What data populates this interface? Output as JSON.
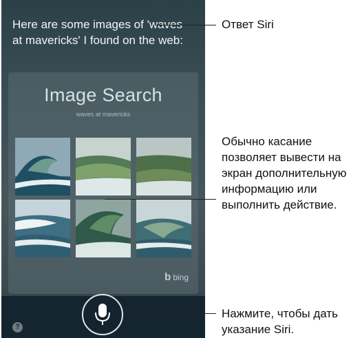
{
  "siri": {
    "response_text": "Here are some images of 'waves at mavericks' I found on the web:"
  },
  "card": {
    "title": "Image Search",
    "subtitle": "waves at mavericks",
    "logo_text": "bing",
    "images": [
      {
        "name": "wave-image-1"
      },
      {
        "name": "wave-image-2"
      },
      {
        "name": "wave-image-3"
      },
      {
        "name": "wave-image-4"
      },
      {
        "name": "wave-image-5"
      },
      {
        "name": "wave-image-6"
      }
    ]
  },
  "buttons": {
    "mic": "microphone-icon",
    "help": "?"
  },
  "callouts": {
    "siri_answer": "Ответ Siri",
    "tap_info": "Обычно касание позволяет вывести на экран дополнительную информацию или выполнить действие.",
    "tap_mic": "Нажмите, чтобы дать указание Siri."
  },
  "colors": {
    "background": "#3b4e55",
    "bottom_bar": "#152530",
    "text": "#f2f5f6"
  }
}
